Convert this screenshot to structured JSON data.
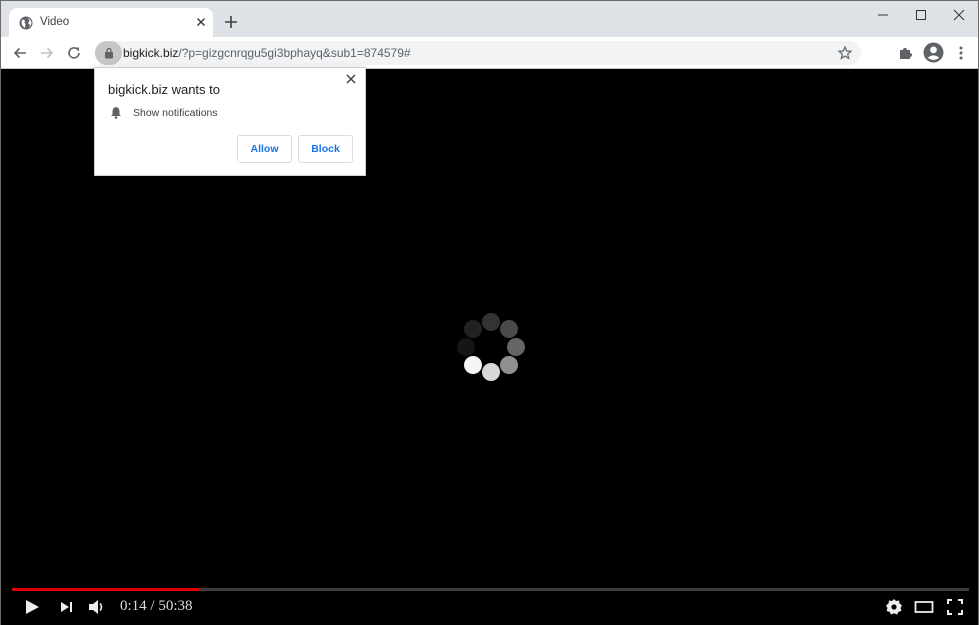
{
  "browser": {
    "tab": {
      "title": "Video",
      "favicon": "globe-icon"
    },
    "address_bar": {
      "host": "bigkick.biz",
      "path": "/?p=gizgcnrqgu5gi3bphayq&sub1=874579#"
    },
    "icons": [
      "back-icon",
      "forward-icon",
      "reload-icon",
      "lock-icon",
      "star-icon",
      "extensions-icon",
      "profile-icon",
      "menu-icon",
      "minimize-icon",
      "maximize-icon",
      "close-icon",
      "new-tab-icon"
    ]
  },
  "permission_popup": {
    "title": "bigkick.biz wants to",
    "permission": "Show notifications",
    "allow_label": "Allow",
    "block_label": "Block"
  },
  "player": {
    "current_time": "0:14",
    "duration": "50:38",
    "time_separator": " / ",
    "progress_fraction": 0.195,
    "colors": {
      "progress": "#e00000",
      "track": "#3d3d3d"
    }
  }
}
